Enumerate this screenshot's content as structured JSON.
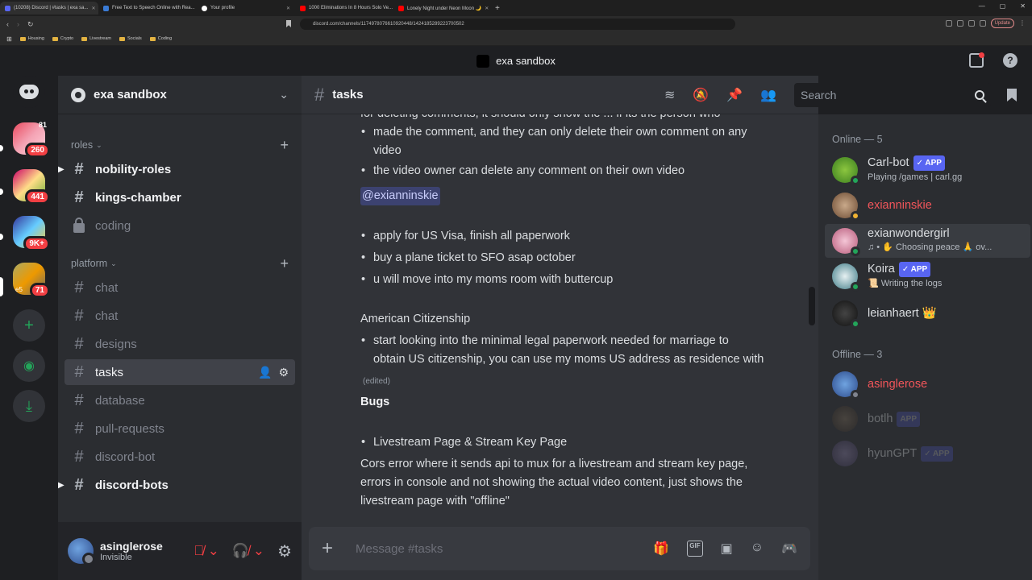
{
  "browser": {
    "tabs": [
      {
        "label": "(10208) Discord | #tasks | exa sa...",
        "color": "#5865f2"
      },
      {
        "label": "Free Text to Speech Online with Rea...",
        "color": "#3a7bd5"
      },
      {
        "label": "Your profile",
        "color": "#ffffff"
      },
      {
        "label": "1000 Eliminations In 8 Hours Solo Ve...",
        "color": "#ff0000"
      },
      {
        "label": "Lonely Night under Neon Moon 🌙",
        "color": "#ff0000"
      }
    ],
    "url": "discord.com/channels/1174978076610920448/1424185289223700502",
    "update_label": "Update",
    "bookmarks": [
      "Housing",
      "Crypto",
      "Livestream",
      "Socials",
      "Coding"
    ]
  },
  "window": {
    "title": "exa sandbox"
  },
  "rail": {
    "badges": {
      "a_top": "81",
      "a": "260",
      "b": "441",
      "c": "9K+",
      "d": "71",
      "d_label": "e5"
    }
  },
  "guild": {
    "name": "exa sandbox"
  },
  "sidebar": {
    "categories": [
      {
        "label": "roles"
      },
      {
        "label": "platform"
      }
    ],
    "channels": [
      {
        "name": "nobility-roles"
      },
      {
        "name": "kings-chamber"
      },
      {
        "name": "coding"
      },
      {
        "name": "chat"
      },
      {
        "name": "chat"
      },
      {
        "name": "designs"
      },
      {
        "name": "tasks"
      },
      {
        "name": "database"
      },
      {
        "name": "pull-requests"
      },
      {
        "name": "discord-bot"
      },
      {
        "name": "discord-bots"
      }
    ]
  },
  "user": {
    "name": "asinglerose",
    "status": "Invisible"
  },
  "channel": {
    "name": "tasks"
  },
  "search": {
    "placeholder": "Search"
  },
  "messages": {
    "partial_top": "for deleting comments, it should only show the ... if its the person who",
    "bullet1": "made the comment, and they can only delete their own comment on any\nvideo",
    "bullet2": "the video owner can delete any comment on their own video",
    "mention": "@exianninskie",
    "todo": [
      "apply for US Visa, finish all paperwork",
      "buy a plane ticket to SFO asap october",
      "u will move into my moms room with buttercup"
    ],
    "citizenship_title": "American Citizenship",
    "citizenship_bullet": "start looking into the minimal legal paperwork needed for marriage to\nobtain US citizenship, you can use my moms US address as residence with",
    "edited": "(edited)",
    "bugs_title": "Bugs",
    "bug_item": "Livestream Page & Stream Key Page",
    "bug_desc": [
      "Cors error where it sends api to mux for a livestream and stream key page,",
      "errors in console and not showing the actual video content, just shows the",
      "livestream page with \"offline\""
    ]
  },
  "composer": {
    "placeholder": "Message #tasks",
    "gif_label": "GIF"
  },
  "members": {
    "online_header": "Online — 5",
    "offline_header": "Offline — 3",
    "online": [
      {
        "name": "Carl-bot",
        "app": "APP",
        "activity": "Playing /games | carl.gg"
      },
      {
        "name": "exianninskie",
        "activity": ""
      },
      {
        "name": "exianwondergirl",
        "activity": "♫ • ✋ Choosing peace 🙏 ov..."
      },
      {
        "name": "Koira",
        "app": "APP",
        "activity": "📜 Writing the logs"
      },
      {
        "name": "leianhaert 👑",
        "activity": ""
      }
    ],
    "offline": [
      {
        "name": "asinglerose"
      },
      {
        "name": "botlh",
        "app": "APP"
      },
      {
        "name": "hyunGPT",
        "app": "APP"
      }
    ]
  },
  "colors": {
    "accent": "#5865f2",
    "online": "#23a55a",
    "danger": "#f23f43",
    "idle": "#f0b232"
  }
}
